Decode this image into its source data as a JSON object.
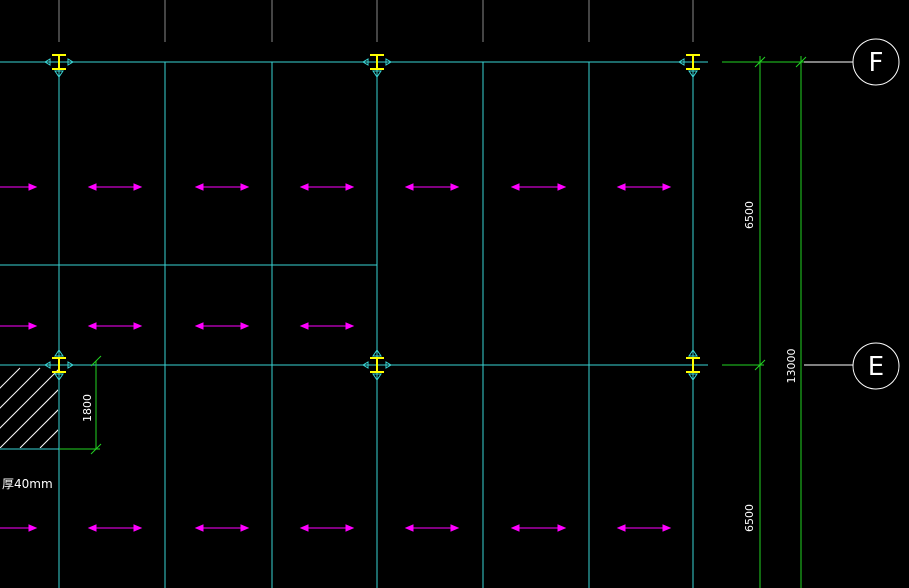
{
  "colors": {
    "background": "#000000",
    "beam_line": "#39d3d3",
    "dimension": "#22d322",
    "load_arrow": "#ff00ff",
    "column_marker": "#ffff00",
    "text": "#ffffff",
    "hatch": "#ffffff"
  },
  "axes": {
    "f_label": "F",
    "e_label": "E"
  },
  "dimensions": {
    "upper_bay": "6500",
    "lower_bay": "6500",
    "total": "13000",
    "slab_edge": "1800"
  },
  "note": {
    "text": "厚40mm"
  },
  "icons": {
    "column": "steel-column-icon",
    "axis_bubble": "axis-bubble-icon",
    "load_arrow": "double-arrow-icon"
  }
}
